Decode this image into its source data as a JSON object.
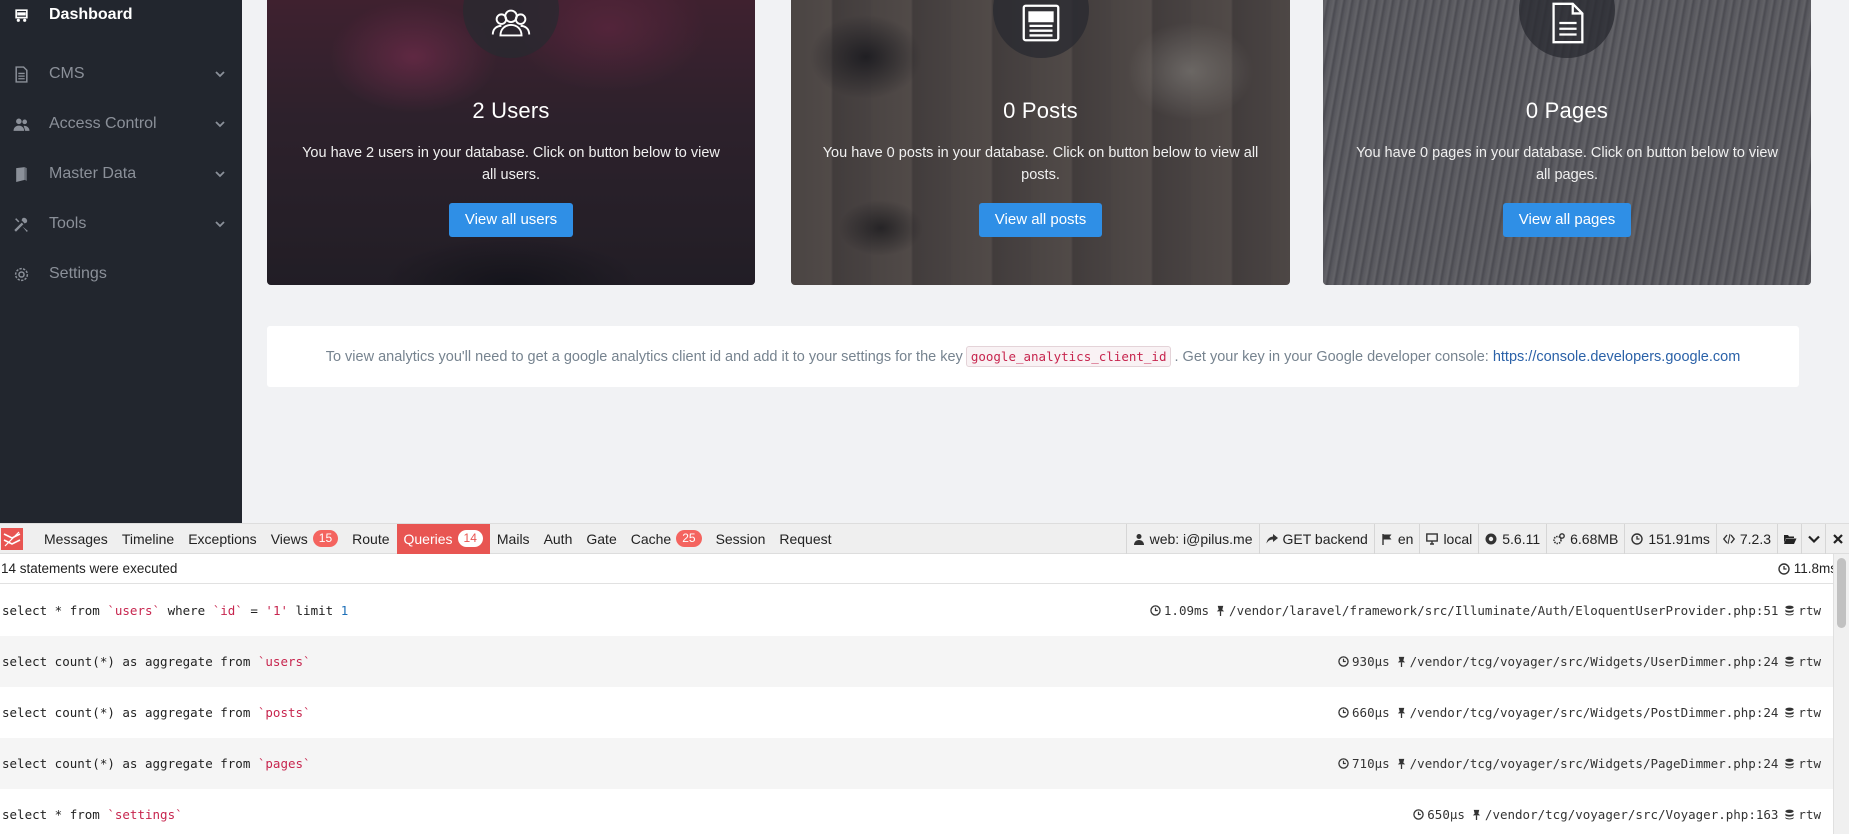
{
  "sidebar": {
    "items": [
      {
        "label": "Dashboard",
        "icon": "dashboard-icon"
      },
      {
        "label": "CMS",
        "icon": "file-icon"
      },
      {
        "label": "Access Control",
        "icon": "people-icon"
      },
      {
        "label": "Master Data",
        "icon": "book-icon"
      },
      {
        "label": "Tools",
        "icon": "tools-icon"
      },
      {
        "label": "Settings",
        "icon": "gear-icon"
      }
    ]
  },
  "cards": [
    {
      "title": "2 Users",
      "text": "You have 2 users in your database. Click on button below to view all users.",
      "button": "View all users",
      "icon": "users-icon"
    },
    {
      "title": "0 Posts",
      "text": "You have 0 posts in your database. Click on button below to view all posts.",
      "button": "View all posts",
      "icon": "newspaper-icon"
    },
    {
      "title": "0 Pages",
      "text": "You have 0 pages in your database. Click on button below to view all pages.",
      "button": "View all pages",
      "icon": "document-icon"
    }
  ],
  "notice": {
    "text_before": "To view analytics you'll need to get a google analytics client id and add it to your settings for the key",
    "code": "google_analytics_client_id",
    "text_after": ". Get your key in your Google developer console:",
    "link": "https://console.developers.google.com"
  },
  "debugbar": {
    "tabs": [
      {
        "label": "Messages"
      },
      {
        "label": "Timeline"
      },
      {
        "label": "Exceptions"
      },
      {
        "label": "Views",
        "badge": "15"
      },
      {
        "label": "Route"
      },
      {
        "label": "Queries",
        "badge": "14",
        "active": true
      },
      {
        "label": "Mails"
      },
      {
        "label": "Auth"
      },
      {
        "label": "Gate"
      },
      {
        "label": "Cache",
        "badge": "25"
      },
      {
        "label": "Session"
      },
      {
        "label": "Request"
      }
    ],
    "indicators": {
      "user": "web: i@pilus.me",
      "route": "GET backend",
      "locale": "en",
      "env": "local",
      "version": "5.6.11",
      "memory": "6.68MB",
      "time": "151.91ms",
      "php": "7.2.3"
    },
    "summary": {
      "statements": "14 statements were executed",
      "duration": "11.8ms"
    },
    "queries": [
      {
        "sql": [
          [
            "select * from ",
            ""
          ],
          [
            "`users`",
            "str"
          ],
          [
            " where ",
            ""
          ],
          [
            "`id`",
            "str"
          ],
          [
            " = ",
            ""
          ],
          [
            "'1'",
            "str"
          ],
          [
            " limit ",
            ""
          ],
          [
            "1",
            "num"
          ]
        ],
        "duration": "1.09ms",
        "source": "/vendor/laravel/framework/src/Illuminate/Auth/EloquentUserProvider.php:51",
        "connection": "rtw"
      },
      {
        "sql": [
          [
            "select count(*) as aggregate from ",
            ""
          ],
          [
            "`users`",
            "str"
          ]
        ],
        "duration": "930μs",
        "source": "/vendor/tcg/voyager/src/Widgets/UserDimmer.php:24",
        "connection": "rtw"
      },
      {
        "sql": [
          [
            "select count(*) as aggregate from ",
            ""
          ],
          [
            "`posts`",
            "str"
          ]
        ],
        "duration": "660μs",
        "source": "/vendor/tcg/voyager/src/Widgets/PostDimmer.php:24",
        "connection": "rtw"
      },
      {
        "sql": [
          [
            "select count(*) as aggregate from ",
            ""
          ],
          [
            "`pages`",
            "str"
          ]
        ],
        "duration": "710μs",
        "source": "/vendor/tcg/voyager/src/Widgets/PageDimmer.php:24",
        "connection": "rtw"
      },
      {
        "sql": [
          [
            "select * from ",
            ""
          ],
          [
            "`settings`",
            "str"
          ]
        ],
        "duration": "650μs",
        "source": "/vendor/tcg/voyager/src/Voyager.php:163",
        "connection": "rtw"
      }
    ]
  }
}
